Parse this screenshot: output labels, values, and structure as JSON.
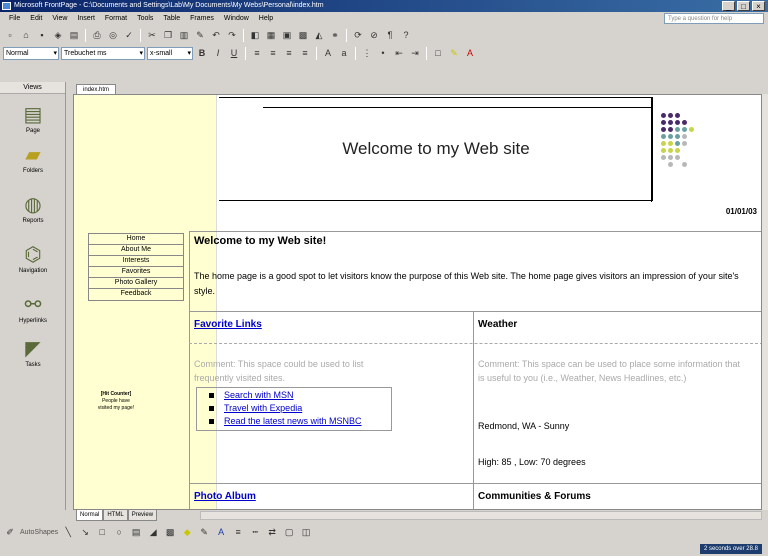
{
  "window": {
    "title": "Microsoft FrontPage - C:\\Documents and Settings\\Lab\\My Documents\\My Webs\\Personal\\index.htm",
    "controls": [
      "_",
      "□",
      "×"
    ]
  },
  "menubar": {
    "items": [
      "File",
      "Edit",
      "View",
      "Insert",
      "Format",
      "Tools",
      "Table",
      "Frames",
      "Window",
      "Help"
    ],
    "help_placeholder": "Type a question for help"
  },
  "formatting": {
    "style": "Normal",
    "font": "Trebuchet ms",
    "size": "x-small"
  },
  "views_bar": {
    "header": "Views",
    "items": [
      {
        "label": "Page",
        "icon": "page-icon"
      },
      {
        "label": "Folders",
        "icon": "folders-icon"
      },
      {
        "label": "Reports",
        "icon": "reports-icon"
      },
      {
        "label": "Navigation",
        "icon": "navigation-icon"
      },
      {
        "label": "Hyperlinks",
        "icon": "hyperlinks-icon"
      },
      {
        "label": "Tasks",
        "icon": "tasks-icon"
      }
    ]
  },
  "document": {
    "tab": "index.htm",
    "banner_title": "Welcome to my Web site",
    "date": "01/01/03",
    "nav_items": [
      "Home",
      "About Me",
      "Interests",
      "Favorites",
      "Photo Gallery",
      "Feedback"
    ],
    "counter": {
      "line1": "[Hit Counter]",
      "line2": "People have",
      "line3": "visited my page!"
    },
    "welcome_heading": "Welcome to my Web site!",
    "welcome_text": "The home page is a good spot to let visitors know the purpose of this Web site. The home page gives visitors an impression of your site's style.",
    "favorite_links": {
      "heading": "Favorite Links",
      "comment": "Comment: This space could be used to list frequently visited sites.",
      "links": [
        "Search with MSN",
        "Travel with Expedia",
        "Read the latest news with MSNBC"
      ]
    },
    "weather": {
      "heading": "Weather",
      "comment": "Comment: This space can be used to place some information that is useful to you (i.e., Weather, News Headlines, etc.)",
      "location": "Redmond, WA - Sunny",
      "forecast": "High: 85 , Low: 70 degrees"
    },
    "photo_album": {
      "heading": "Photo Album"
    },
    "communities": {
      "heading": "Communities & Forums"
    }
  },
  "view_tabs": [
    "Normal",
    "HTML",
    "Preview"
  ],
  "drawing": {
    "autoshapes": "AutoShapes"
  },
  "status": {
    "timing": "2 seconds over 28.8"
  },
  "colors": {
    "left_column": "#ffffd2",
    "link": "#0000cc",
    "dot_purple": "#4a2a6a",
    "dot_yellow": "#c8d44a",
    "dot_teal": "#6aa0a0",
    "dot_grey": "#b8b8b8"
  }
}
